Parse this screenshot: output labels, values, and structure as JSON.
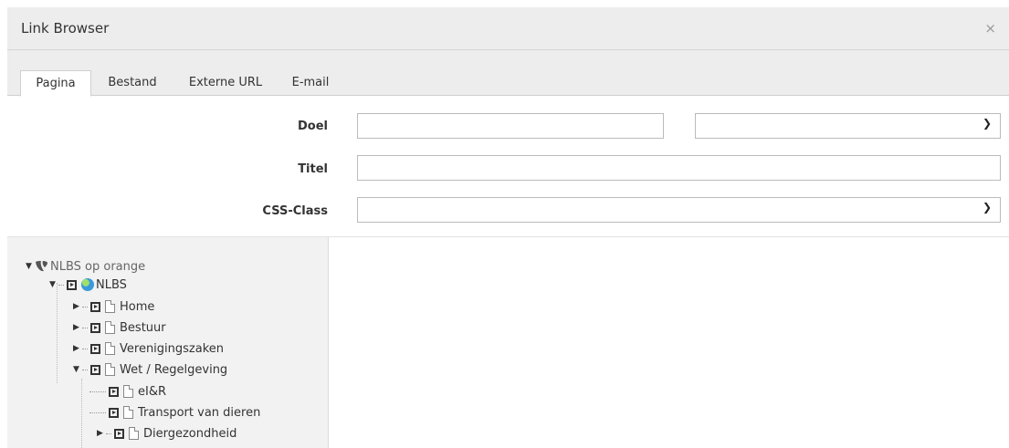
{
  "dialog": {
    "title": "Link Browser",
    "close": "×"
  },
  "tabs": [
    {
      "label": "Pagina",
      "active": true
    },
    {
      "label": "Bestand",
      "active": false
    },
    {
      "label": "Externe URL",
      "active": false
    },
    {
      "label": "E-mail",
      "active": false
    }
  ],
  "form": {
    "target_label": "Doel",
    "target_value": "",
    "target_select_value": "",
    "title_label": "Titel",
    "title_value": "",
    "css_label": "CSS-Class",
    "css_value": ""
  },
  "tree": {
    "root": "NLBS op orange",
    "site": "NLBS",
    "pages": [
      "Home",
      "Bestuur",
      "Verenigingszaken",
      "Wet / Regelgeving"
    ],
    "subpages": [
      "eI&R",
      "Transport van dieren",
      "Diergezondheid"
    ]
  },
  "icons": {
    "close": "close-icon",
    "chevron": "chevron-down-icon",
    "expand": "expand-arrow-icon",
    "collapse": "collapse-arrow-icon",
    "page": "page-icon",
    "globe": "globe-icon",
    "logo": "typo3-logo-icon"
  }
}
